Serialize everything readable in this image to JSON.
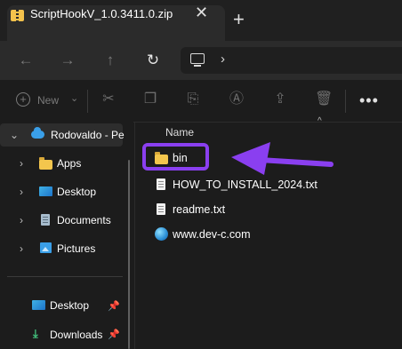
{
  "tab": {
    "title": "ScriptHookV_1.0.3411.0.zip",
    "close_glyph": "✕",
    "new_tab_glyph": "+",
    "icon": "zip-folder-icon"
  },
  "nav": {
    "back_glyph": "←",
    "forward_glyph": "→",
    "up_glyph": "↑",
    "refresh_glyph": "↻",
    "address_chevron": "›"
  },
  "command_bar": {
    "new_label": "New",
    "new_caret": "⌄",
    "more_glyph": "•••",
    "icons": [
      "cut-icon",
      "copy-icon",
      "paste-icon",
      "rename-icon",
      "share-icon",
      "delete-icon"
    ]
  },
  "sidebar": {
    "onedrive_label": "Rodovaldo - Pe",
    "items": [
      {
        "label": "Apps",
        "icon": "folder-icon"
      },
      {
        "label": "Desktop",
        "icon": "desktop-icon"
      },
      {
        "label": "Documents",
        "icon": "documents-icon"
      },
      {
        "label": "Pictures",
        "icon": "pictures-icon"
      }
    ],
    "quick_access": [
      {
        "label": "Desktop",
        "icon": "desktop-icon",
        "pinned": true
      },
      {
        "label": "Downloads",
        "icon": "downloads-icon",
        "pinned": true
      }
    ]
  },
  "file_list": {
    "column_header": "Name",
    "sort_glyph": "^",
    "files": [
      {
        "name": "bin",
        "type": "folder",
        "highlighted": true
      },
      {
        "name": "HOW_TO_INSTALL_2024.txt",
        "type": "text"
      },
      {
        "name": "readme.txt",
        "type": "text"
      },
      {
        "name": "www.dev-c.com",
        "type": "url"
      }
    ]
  },
  "annotation": {
    "highlight_color": "#8a3ff0",
    "arrow_color": "#8a3ff0"
  },
  "colors": {
    "background": "#1c1c1c",
    "folder": "#f3c64d",
    "onedrive": "#3a9fe8"
  }
}
